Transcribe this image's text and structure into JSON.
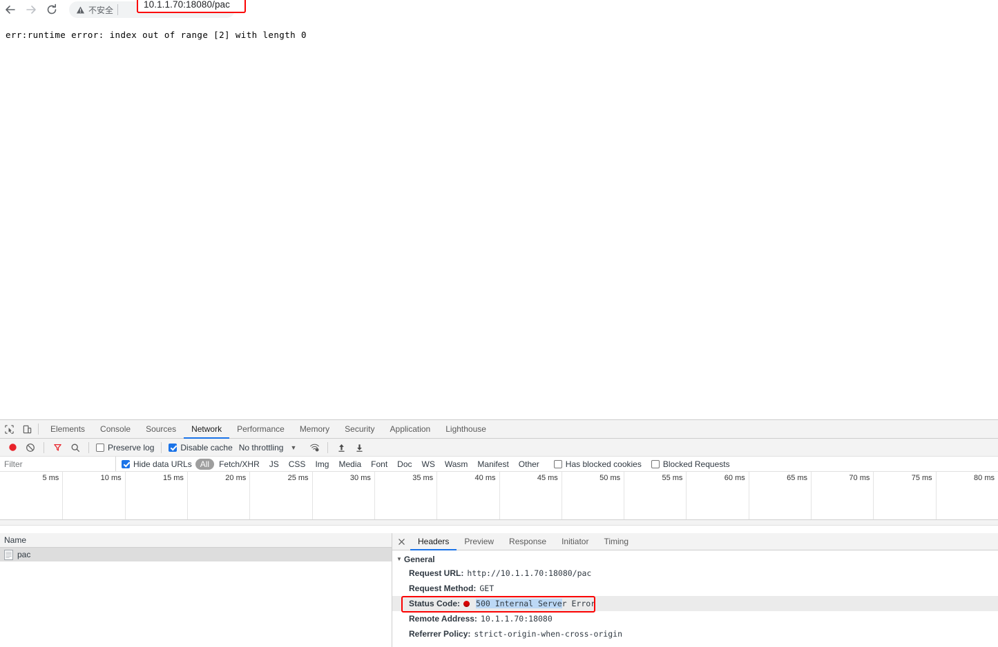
{
  "browser": {
    "back_icon": "arrow-left-icon",
    "forward_icon": "arrow-right-icon",
    "reload_icon": "reload-icon",
    "security_label": "不安全",
    "security_icon": "warning-triangle-icon",
    "url": "10.1.1.70:18080/pac",
    "highlight_color": "#fb0000"
  },
  "page": {
    "error_text": "err:runtime error: index out of range [2] with length 0"
  },
  "devtools": {
    "inspect_icon": "inspect-element-icon",
    "device_icon": "device-toolbar-icon",
    "tabs": [
      {
        "label": "Elements",
        "active": false
      },
      {
        "label": "Console",
        "active": false
      },
      {
        "label": "Sources",
        "active": false
      },
      {
        "label": "Network",
        "active": true
      },
      {
        "label": "Performance",
        "active": false
      },
      {
        "label": "Memory",
        "active": false
      },
      {
        "label": "Security",
        "active": false
      },
      {
        "label": "Application",
        "active": false
      },
      {
        "label": "Lighthouse",
        "active": false
      }
    ],
    "network_toolbar": {
      "record_icon": "record-circle-icon",
      "clear_icon": "clear-circle-slash-icon",
      "filter_icon": "filter-funnel-icon",
      "search_icon": "search-icon",
      "preserve_log_label": "Preserve log",
      "preserve_log_checked": false,
      "disable_cache_label": "Disable cache",
      "disable_cache_checked": true,
      "throttling_label": "No throttling",
      "throttle_caret": "▼",
      "wifi_icon": "network-conditions-icon",
      "import_icon": "import-har-icon",
      "export_icon": "export-har-icon"
    },
    "filter_row": {
      "filter_placeholder": "Filter",
      "filter_value": "",
      "hide_data_urls_label": "Hide data URLs",
      "hide_data_urls_checked": true,
      "types": [
        {
          "label": "All",
          "active": true
        },
        {
          "label": "Fetch/XHR",
          "active": false
        },
        {
          "label": "JS",
          "active": false
        },
        {
          "label": "CSS",
          "active": false
        },
        {
          "label": "Img",
          "active": false
        },
        {
          "label": "Media",
          "active": false
        },
        {
          "label": "Font",
          "active": false
        },
        {
          "label": "Doc",
          "active": false
        },
        {
          "label": "WS",
          "active": false
        },
        {
          "label": "Wasm",
          "active": false
        },
        {
          "label": "Manifest",
          "active": false
        },
        {
          "label": "Other",
          "active": false
        }
      ],
      "has_blocked_cookies_label": "Has blocked cookies",
      "has_blocked_cookies_checked": false,
      "blocked_requests_label": "Blocked Requests",
      "blocked_requests_checked": false
    },
    "overview": {
      "tick_labels": [
        "5 ms",
        "10 ms",
        "15 ms",
        "20 ms",
        "25 ms",
        "30 ms",
        "35 ms",
        "40 ms",
        "45 ms",
        "50 ms",
        "55 ms",
        "60 ms",
        "65 ms",
        "70 ms",
        "75 ms",
        "80 ms"
      ]
    },
    "request_list": {
      "column_header": "Name",
      "rows": [
        {
          "name": "pac",
          "icon": "document-icon",
          "selected": true
        }
      ]
    },
    "details": {
      "close_icon": "close-icon",
      "tabs": [
        {
          "label": "Headers",
          "active": true
        },
        {
          "label": "Preview",
          "active": false
        },
        {
          "label": "Response",
          "active": false
        },
        {
          "label": "Initiator",
          "active": false
        },
        {
          "label": "Timing",
          "active": false
        }
      ],
      "general_section_label": "General",
      "rows": [
        {
          "name": "Request URL:",
          "value": "http://10.1.1.70:18080/pac"
        },
        {
          "name": "Request Method:",
          "value": "GET"
        },
        {
          "name": "Status Code:",
          "value_selected": "500 Internal Serve",
          "value_rest": "r Error",
          "status_icon": "red-status-dot-icon",
          "highlighted": true
        },
        {
          "name": "Remote Address:",
          "value": "10.1.1.70:18080"
        },
        {
          "name": "Referrer Policy:",
          "value": "strict-origin-when-cross-origin"
        }
      ]
    }
  }
}
